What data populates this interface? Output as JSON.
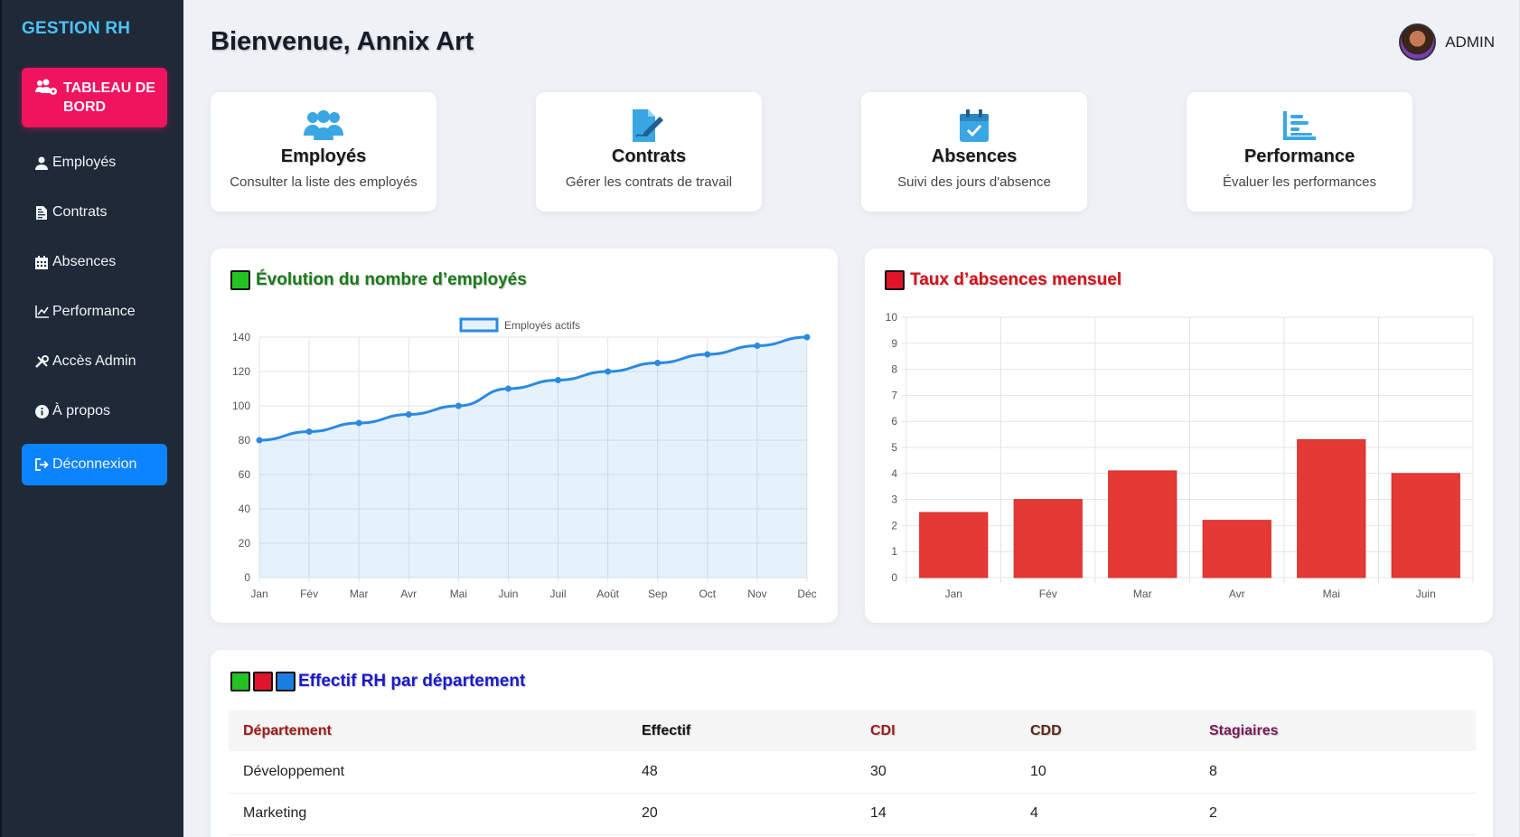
{
  "app": {
    "brand": "GESTION RH"
  },
  "sidebar": {
    "items": [
      {
        "label": "TABLEAU DE BORD",
        "icon": "users-cog-icon"
      },
      {
        "label": "Employés",
        "icon": "user-icon"
      },
      {
        "label": "Contrats",
        "icon": "file-contract-icon"
      },
      {
        "label": "Absences",
        "icon": "calendar-icon"
      },
      {
        "label": "Performance",
        "icon": "chart-line-icon"
      },
      {
        "label": "Accès Admin",
        "icon": "tools-icon"
      },
      {
        "label": "À propos",
        "icon": "info-icon"
      },
      {
        "label": "Déconnexion",
        "icon": "sign-out-icon"
      }
    ]
  },
  "header": {
    "title": "Bienvenue, Annix Art",
    "user": "ADMIN"
  },
  "cards": [
    {
      "title": "Employés",
      "desc": "Consulter la liste des employés",
      "icon": "users-icon"
    },
    {
      "title": "Contrats",
      "desc": "Gérer les contrats de travail",
      "icon": "file-signature-icon"
    },
    {
      "title": "Absences",
      "desc": "Suivi des jours d'absence",
      "icon": "calendar-check-icon"
    },
    {
      "title": "Performance",
      "desc": "Évaluer les performances",
      "icon": "chart-bar-icon"
    }
  ],
  "colors": {
    "accent_pink": "#f0145f",
    "accent_blue": "#0d84ff",
    "line": "#2b8ae0",
    "bar": "#e53935"
  },
  "panels": {
    "line_title": "Évolution du nombre d’employés",
    "bar_title": "Taux d’absences mensuel",
    "table_title": "Effectif RH par département"
  },
  "chart_data": [
    {
      "type": "line",
      "title": "Évolution du nombre d’employés",
      "categories": [
        "Jan",
        "Fév",
        "Mar",
        "Avr",
        "Mai",
        "Juin",
        "Juil",
        "Août",
        "Sep",
        "Oct",
        "Nov",
        "Déc"
      ],
      "series": [
        {
          "name": "Employés actifs",
          "values": [
            80,
            85,
            90,
            95,
            100,
            110,
            115,
            120,
            125,
            130,
            135,
            140
          ]
        }
      ],
      "ylim": [
        0,
        140
      ],
      "yticks": [
        0,
        20,
        40,
        60,
        80,
        100,
        120,
        140
      ],
      "grid": true,
      "legend": "top-center"
    },
    {
      "type": "bar",
      "title": "Taux d’absences mensuel",
      "categories": [
        "Jan",
        "Fév",
        "Mar",
        "Avr",
        "Mai",
        "Juin"
      ],
      "values": [
        2.5,
        3,
        4.1,
        2.2,
        5.3,
        4
      ],
      "ylim": [
        0,
        10
      ],
      "yticks": [
        0,
        1,
        2,
        3,
        4,
        5,
        6,
        7,
        8,
        9,
        10
      ],
      "grid": true
    }
  ],
  "table": {
    "headers": [
      "Département",
      "Effectif",
      "CDI",
      "CDD",
      "Stagiaires"
    ],
    "header_colors": [
      "#9b1c1c",
      "#111111",
      "#9b1c1c",
      "#5a2a1a",
      "#7a1a5a"
    ],
    "rows": [
      [
        "Développement",
        "48",
        "30",
        "10",
        "8"
      ],
      [
        "Marketing",
        "20",
        "14",
        "4",
        "2"
      ]
    ]
  }
}
